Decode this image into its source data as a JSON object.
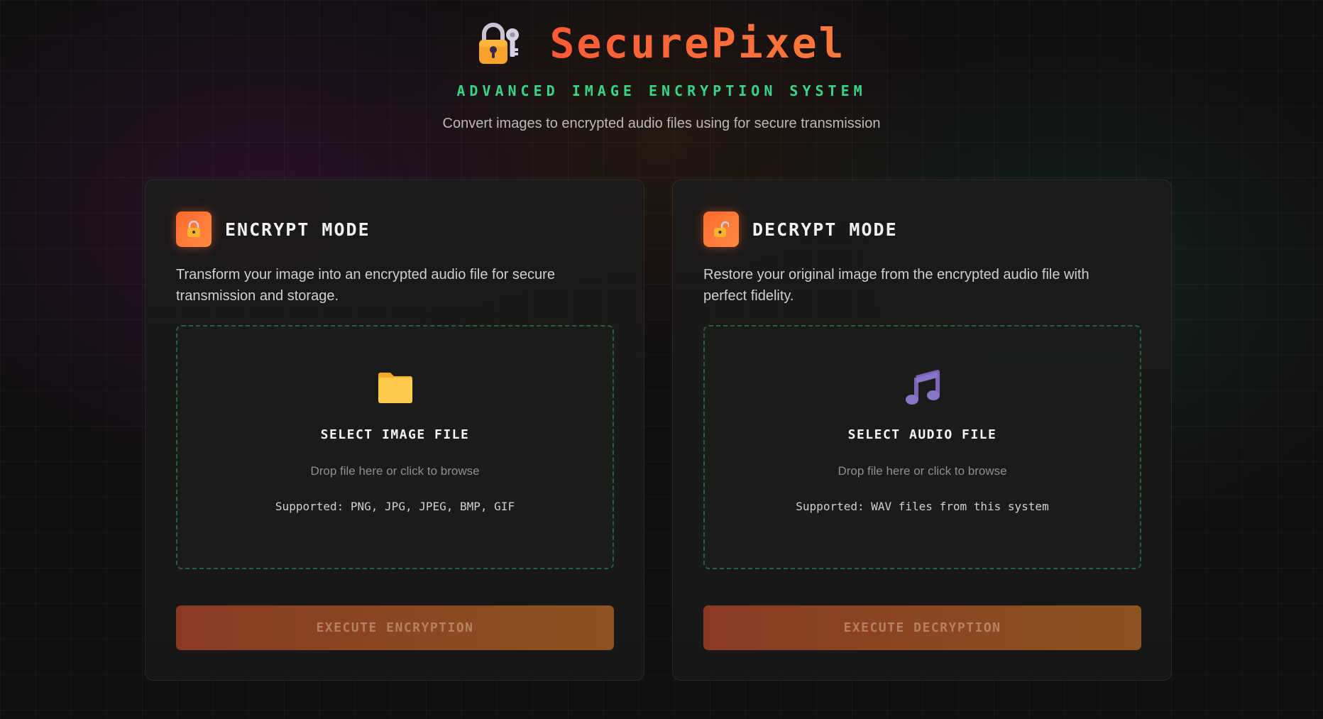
{
  "header": {
    "app_title": "SecurePixel",
    "subtitle": "ADVANCED IMAGE ENCRYPTION SYSTEM",
    "tagline": "Convert images to encrypted audio files using for secure transmission",
    "logo_icon": "lock-with-key-icon"
  },
  "colors": {
    "accent_orange": "#ff6a3a",
    "accent_green": "#36d68a",
    "background": "#120f12"
  },
  "encrypt": {
    "icon": "locked-icon",
    "title": "ENCRYPT MODE",
    "description": "Transform your image into an encrypted audio file for secure transmission and storage.",
    "dropzone": {
      "icon": "folder-icon",
      "title": "SELECT IMAGE FILE",
      "hint": "Drop file here or click to browse",
      "supported": "Supported: PNG, JPG, JPEG, BMP, GIF"
    },
    "button_label": "EXECUTE ENCRYPTION"
  },
  "decrypt": {
    "icon": "unlocked-icon",
    "title": "DECRYPT MODE",
    "description": "Restore your original image from the encrypted audio file with perfect fidelity.",
    "dropzone": {
      "icon": "music-note-icon",
      "title": "SELECT AUDIO FILE",
      "hint": "Drop file here or click to browse",
      "supported": "Supported: WAV files from this system"
    },
    "button_label": "EXECUTE DECRYPTION"
  }
}
